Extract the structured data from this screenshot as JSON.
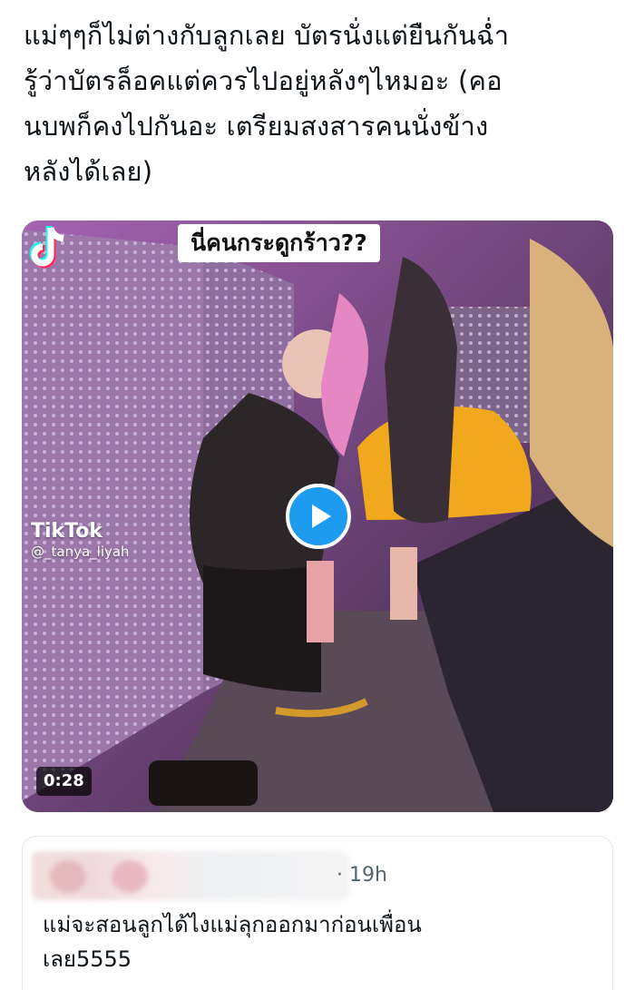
{
  "post": {
    "text_lines": [
      "แม่ๆๆก็ไม่ต่างกับลูกเลย บัตรนั่งแต่ยืนกันฉ่ำ",
      "รู้ว่าบัตรล็อคแต่ควรไปอยู่หลังๆไหมอะ (คอ",
      "นบพก็คงไปกันอะ เตรียมสงสารคนนั่งข้าง",
      "หลังได้เลย)"
    ]
  },
  "media": {
    "caption": "นี่คนกระดูกร้าว??",
    "watermark_brand": "TikTok",
    "watermark_handle": "@_tanya_liyah",
    "duration": "0:28",
    "play_icon": "play-icon",
    "accent_color": "#1d9bf0"
  },
  "reply": {
    "time": "· 19h",
    "text_lines": [
      "แม่จะสอนลูกได้ไงแม่ลุกออกมาก่อนเพื่อน",
      "เลย5555"
    ]
  }
}
